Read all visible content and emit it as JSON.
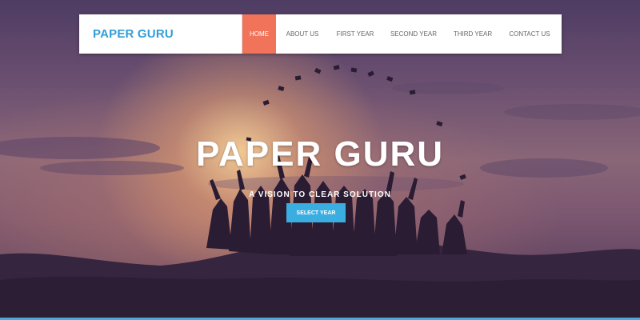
{
  "navbar": {
    "brand": "PAPER GURU",
    "links": [
      {
        "label": "HOME",
        "active": true
      },
      {
        "label": "ABOUT US",
        "active": false
      },
      {
        "label": "FIRST YEAR",
        "active": false
      },
      {
        "label": "SECOND YEAR",
        "active": false
      },
      {
        "label": "THIRD YEAR",
        "active": false
      },
      {
        "label": "CONTACT US",
        "active": false
      }
    ]
  },
  "hero": {
    "title": "PAPER GURU",
    "subtitle": "A VISION TO CLEAR SOLUTION",
    "cta_label": "SELECT YEAR"
  },
  "colors": {
    "brand": "#2f9ed8",
    "active_nav": "#f0735a",
    "cta": "#3aaee0"
  }
}
